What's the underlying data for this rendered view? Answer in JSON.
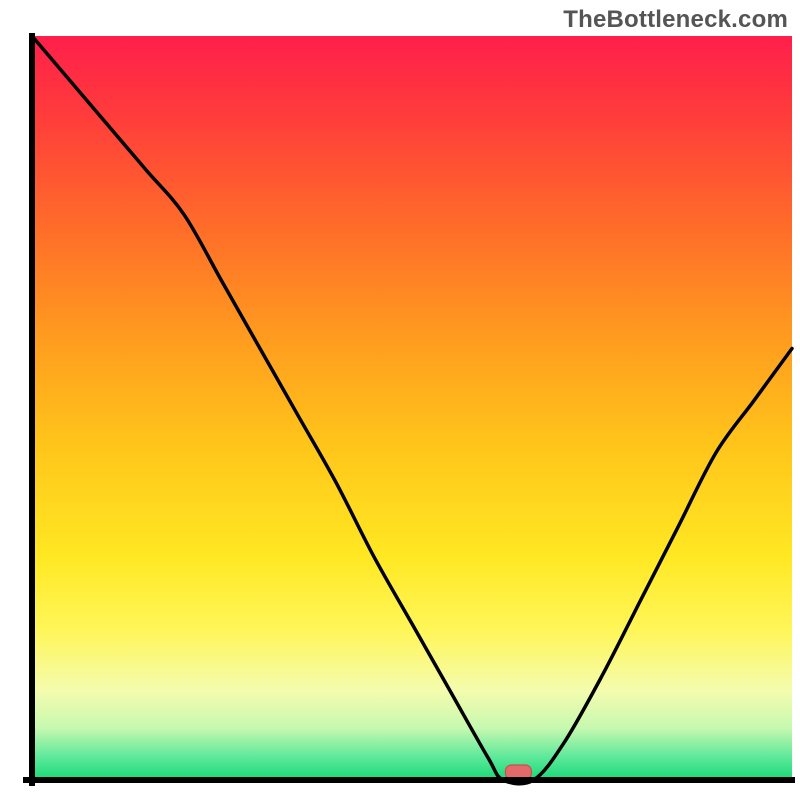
{
  "watermark": "TheBottleneck.com",
  "chart_data": {
    "type": "line",
    "title": "",
    "xlabel": "",
    "ylabel": "",
    "xlim": [
      0,
      100
    ],
    "ylim": [
      0,
      100
    ],
    "series": [
      {
        "name": "curve",
        "x": [
          0,
          5,
          10,
          15,
          20,
          25,
          30,
          35,
          40,
          45,
          50,
          55,
          60,
          62,
          66,
          70,
          75,
          80,
          85,
          90,
          95,
          100
        ],
        "values": [
          100,
          94,
          88,
          82,
          76,
          67,
          58,
          49,
          40,
          30,
          21,
          12,
          3,
          0,
          0,
          5,
          14,
          24,
          34,
          44,
          51,
          58
        ]
      }
    ],
    "optimal_point": {
      "x": 64,
      "y": 0
    },
    "gradient_stops": [
      {
        "offset": 0.0,
        "color": "#ff1f4b"
      },
      {
        "offset": 0.1,
        "color": "#ff3a3c"
      },
      {
        "offset": 0.25,
        "color": "#ff6a2a"
      },
      {
        "offset": 0.4,
        "color": "#ff9a1f"
      },
      {
        "offset": 0.55,
        "color": "#ffc51a"
      },
      {
        "offset": 0.7,
        "color": "#ffe823"
      },
      {
        "offset": 0.8,
        "color": "#fff65a"
      },
      {
        "offset": 0.88,
        "color": "#f4fcae"
      },
      {
        "offset": 0.93,
        "color": "#c7f8b0"
      },
      {
        "offset": 0.97,
        "color": "#5be89a"
      },
      {
        "offset": 1.0,
        "color": "#18d976"
      }
    ],
    "colors": {
      "axis": "#000000",
      "curve": "#000000",
      "marker_fill": "#e36a6a",
      "marker_stroke": "#c94f4f",
      "background": "#ffffff"
    }
  }
}
